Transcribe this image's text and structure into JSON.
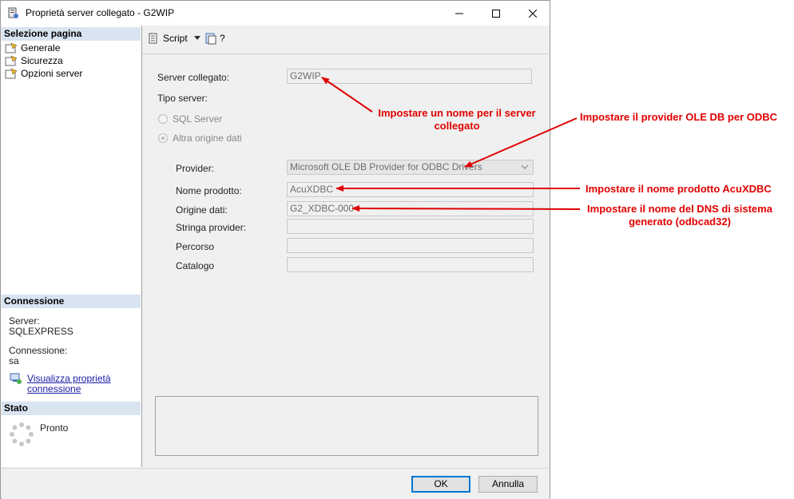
{
  "window": {
    "title": "Proprietà server collegato - G2WIP",
    "controls": {
      "minimize": "—",
      "maximize": "☐",
      "close": "✕"
    }
  },
  "sidebar": {
    "select_page_header": "Selezione pagina",
    "pages": [
      {
        "label": "Generale"
      },
      {
        "label": "Sicurezza"
      },
      {
        "label": "Opzioni server"
      }
    ],
    "connection_header": "Connessione",
    "server_label": "Server:",
    "server_value": "SQLEXPRESS",
    "connection_label": "Connessione:",
    "connection_value": "sa",
    "view_connection_link_line1": "Visualizza proprietà",
    "view_connection_link_line2": "connessione",
    "status_header": "Stato",
    "status_value": "Pronto"
  },
  "toolbar": {
    "script_label": "Script",
    "help_label": "?"
  },
  "form": {
    "linked_server_label": "Server collegato:",
    "linked_server_value": "G2WIP",
    "server_type_label": "Tipo server:",
    "sql_server_option": "SQL Server",
    "other_source_option": "Altra origine dati",
    "provider_label": "Provider:",
    "provider_value": "Microsoft OLE DB Provider for ODBC Drivers",
    "product_name_label": "Nome prodotto:",
    "product_name_value": "AcuXDBC",
    "data_source_label": "Origine dati:",
    "data_source_value": "G2_XDBC-000",
    "provider_string_label": "Stringa provider:",
    "provider_string_value": "",
    "location_label": "Percorso",
    "location_value": "",
    "catalog_label": "Catalogo",
    "catalog_value": ""
  },
  "buttons": {
    "ok": "OK",
    "cancel": "Annulla"
  },
  "annotations": {
    "server_name_line1": "Impostare un nome per il server",
    "server_name_line2": "collegato",
    "provider": "Impostare il provider OLE DB per ODBC",
    "product_name": "Impostare il nome prodotto AcuXDBC",
    "dns_line1": "Impostare il nome del DNS di sistema",
    "dns_line2": "generato (odbcad32)"
  },
  "colors": {
    "annotation": "#e00000",
    "section_header_bg": "#d9e4f1",
    "default_button_border": "#0078d7"
  }
}
